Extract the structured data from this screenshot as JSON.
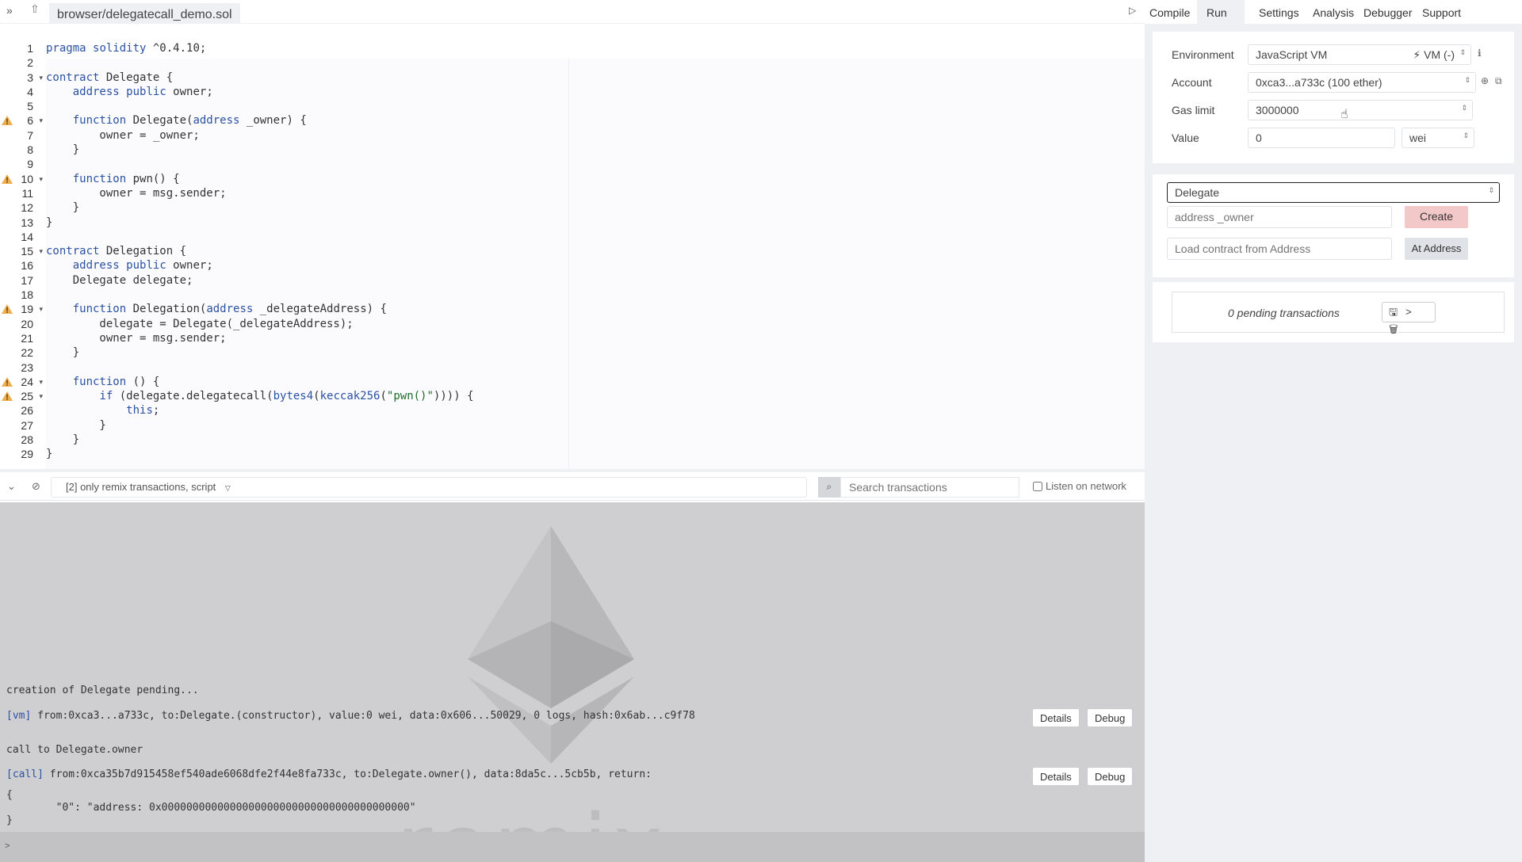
{
  "top": {
    "file_tab": "browser/delegatecall_demo.sol"
  },
  "right_tabs": [
    "Compile",
    "Run",
    "Settings",
    "Analysis",
    "Debugger",
    "Support"
  ],
  "editor": {
    "lines": [
      "pragma solidity ^0.4.10;",
      "",
      "contract Delegate {",
      "    address public owner;",
      "",
      "    function Delegate(address _owner) {",
      "        owner = _owner;",
      "    }",
      "",
      "    function pwn() {",
      "        owner = msg.sender;",
      "    }",
      "}",
      "",
      "contract Delegation {",
      "    address public owner;",
      "    Delegate delegate;",
      "",
      "    function Delegation(address _delegateAddress) {",
      "        delegate = Delegate(_delegateAddress);",
      "        owner = msg.sender;",
      "    }",
      "",
      "    function () {",
      "        if (delegate.delegatecall(bytes4(keccak256(\"pwn()\")))) {",
      "            this;",
      "        }",
      "    }",
      "}"
    ],
    "warning_lines": [
      6,
      10,
      19,
      24,
      25
    ],
    "fold_lines": [
      3,
      6,
      10,
      15,
      19,
      24,
      25
    ]
  },
  "terminal_bar": {
    "filter_text": "[2] only remix transactions, script",
    "search_placeholder": "Search transactions",
    "listen_label": "Listen on network"
  },
  "terminal": {
    "creation_msg": "creation of Delegate pending...",
    "vm_tag": "[vm]",
    "vm_line": " from:0xca3...a733c, to:Delegate.(constructor), value:0 wei, data:0x606...50029, 0 logs, hash:0x6ab...c9f78",
    "call_msg": "call to Delegate.owner",
    "call_tag": "[call]",
    "call_line": " from:0xca35b7d915458ef540ade6068dfe2f44e8fa733c, to:Delegate.owner(), data:8da5c...5cb5b, return:",
    "return_open": "{",
    "return_value": "        \"0\": \"address: 0x0000000000000000000000000000000000000000\"",
    "return_close": "}",
    "details_label": "Details",
    "debug_label": "Debug",
    "watermark": "remix",
    "footer_prompt": ">"
  },
  "run_panel": {
    "environment_label": "Environment",
    "environment_value": "JavaScript VM",
    "environment_suffix": "VM (-)",
    "account_label": "Account",
    "account_value": "0xca3...a733c (100 ether)",
    "gas_label": "Gas limit",
    "gas_value": "3000000",
    "value_label": "Value",
    "value_amount": "0",
    "value_unit": "wei",
    "contract_select": "Delegate",
    "constructor_placeholder": "address _owner",
    "create_label": "Create",
    "load_placeholder": "Load contract from Address",
    "at_address_label": "At Address",
    "pending_text": "0 pending transactions"
  }
}
